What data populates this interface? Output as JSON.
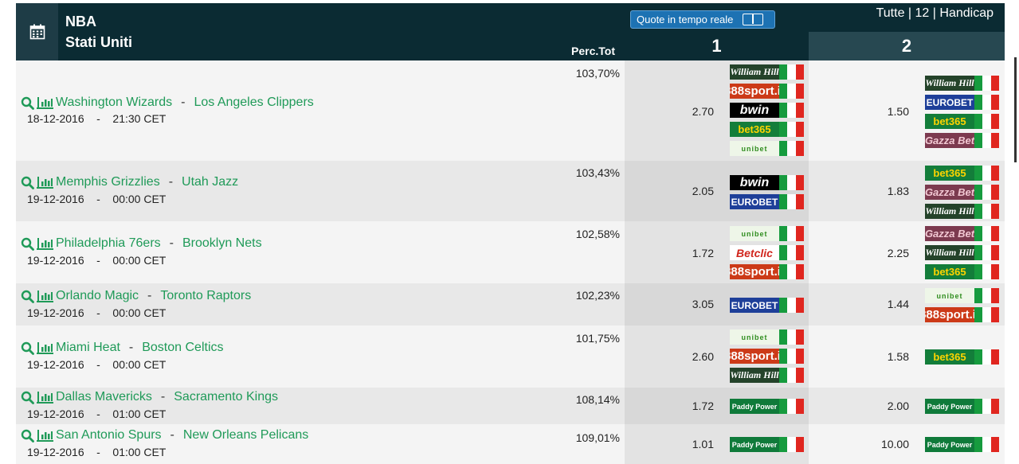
{
  "header": {
    "league": "NBA",
    "country": "Stati Uniti",
    "perc_label": "Perc.Tot",
    "col1_label": "1",
    "col2_label": "2",
    "live_label": "Quote in tempo reale",
    "filters": [
      "Tutte",
      "12",
      "Handicap"
    ],
    "filter_sep": "|"
  },
  "colors": {
    "link": "#1f9a58",
    "header_bg": "#0b2b33",
    "button": "#1d72b3"
  },
  "matches": [
    {
      "home": "Washington Wizards",
      "away": "Los Angeles Clippers",
      "date": "18-12-2016",
      "time": "21:30 CET",
      "pct": "103,70%",
      "odd1": "2.70",
      "odd2": "1.50",
      "bk1": [
        {
          "name": "William Hill",
          "cls": "wh"
        },
        {
          "name": "888sport.it",
          "cls": "s888"
        },
        {
          "name": "bwin",
          "cls": "bwin"
        },
        {
          "name": "bet365",
          "cls": "b365"
        },
        {
          "name": "unibet",
          "cls": "unibet"
        }
      ],
      "bk2": [
        {
          "name": "William Hill",
          "cls": "wh"
        },
        {
          "name": "EUROBET",
          "cls": "eurobet"
        },
        {
          "name": "bet365",
          "cls": "b365"
        },
        {
          "name": "Gazza Bet",
          "cls": "gazza"
        }
      ]
    },
    {
      "home": "Memphis Grizzlies",
      "away": "Utah Jazz",
      "date": "19-12-2016",
      "time": "00:00 CET",
      "pct": "103,43%",
      "odd1": "2.05",
      "odd2": "1.83",
      "bk1": [
        {
          "name": "bwin",
          "cls": "bwin"
        },
        {
          "name": "EUROBET",
          "cls": "eurobet"
        }
      ],
      "bk2": [
        {
          "name": "bet365",
          "cls": "b365"
        },
        {
          "name": "Gazza Bet",
          "cls": "gazza"
        },
        {
          "name": "William Hill",
          "cls": "wh"
        }
      ]
    },
    {
      "home": "Philadelphia 76ers",
      "away": "Brooklyn Nets",
      "date": "19-12-2016",
      "time": "00:00 CET",
      "pct": "102,58%",
      "odd1": "1.72",
      "odd2": "2.25",
      "bk1": [
        {
          "name": "unibet",
          "cls": "unibet"
        },
        {
          "name": "Betclic",
          "cls": "betclic"
        },
        {
          "name": "888sport.it",
          "cls": "s888"
        }
      ],
      "bk2": [
        {
          "name": "Gazza Bet",
          "cls": "gazza"
        },
        {
          "name": "William Hill",
          "cls": "wh"
        },
        {
          "name": "bet365",
          "cls": "b365"
        }
      ]
    },
    {
      "home": "Orlando Magic",
      "away": "Toronto Raptors",
      "date": "19-12-2016",
      "time": "00:00 CET",
      "pct": "102,23%",
      "odd1": "3.05",
      "odd2": "1.44",
      "bk1": [
        {
          "name": "EUROBET",
          "cls": "eurobet"
        }
      ],
      "bk2": [
        {
          "name": "unibet",
          "cls": "unibet"
        },
        {
          "name": "888sport.it",
          "cls": "s888"
        }
      ]
    },
    {
      "home": "Miami Heat",
      "away": "Boston Celtics",
      "date": "19-12-2016",
      "time": "00:00 CET",
      "pct": "101,75%",
      "odd1": "2.60",
      "odd2": "1.58",
      "bk1": [
        {
          "name": "unibet",
          "cls": "unibet"
        },
        {
          "name": "888sport.it",
          "cls": "s888"
        },
        {
          "name": "William Hill",
          "cls": "wh"
        }
      ],
      "bk2": [
        {
          "name": "bet365",
          "cls": "b365"
        }
      ]
    },
    {
      "home": "Dallas Mavericks",
      "away": "Sacramento Kings",
      "date": "19-12-2016",
      "time": "01:00 CET",
      "pct": "108,14%",
      "odd1": "1.72",
      "odd2": "2.00",
      "bk1": [
        {
          "name": "Paddy Power",
          "cls": "paddy"
        }
      ],
      "bk2": [
        {
          "name": "Paddy Power",
          "cls": "paddy"
        }
      ]
    },
    {
      "home": "San Antonio Spurs",
      "away": "New Orleans Pelicans",
      "date": "19-12-2016",
      "time": "01:00 CET",
      "pct": "109,01%",
      "odd1": "1.01",
      "odd2": "10.00",
      "bk1": [
        {
          "name": "Paddy Power",
          "cls": "paddy"
        }
      ],
      "bk2": [
        {
          "name": "Paddy Power",
          "cls": "paddy"
        }
      ]
    }
  ]
}
